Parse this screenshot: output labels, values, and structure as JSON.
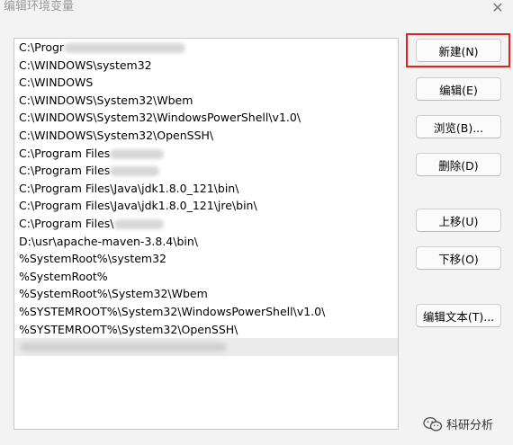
{
  "window": {
    "title": "编辑环境变量",
    "close_glyph": "✕"
  },
  "list": {
    "items": [
      {
        "text": "C:\\Progr",
        "redacted": true
      },
      {
        "text": "C:\\WINDOWS\\system32"
      },
      {
        "text": "C:\\WINDOWS"
      },
      {
        "text": "C:\\WINDOWS\\System32\\Wbem"
      },
      {
        "text": "C:\\WINDOWS\\System32\\WindowsPowerShell\\v1.0\\"
      },
      {
        "text": "C:\\WINDOWS\\System32\\OpenSSH\\"
      },
      {
        "text": "C:\\Program Files",
        "redacted": true
      },
      {
        "text": "C:\\Program Files",
        "redacted": true
      },
      {
        "text": "C:\\Program Files\\Java\\jdk1.8.0_121\\bin\\"
      },
      {
        "text": "C:\\Program Files\\Java\\jdk1.8.0_121\\jre\\bin\\"
      },
      {
        "text": "C:\\Program Files\\",
        "redacted": true
      },
      {
        "text": "D:\\usr\\apache-maven-3.8.4\\bin\\"
      },
      {
        "text": "%SystemRoot%\\system32"
      },
      {
        "text": "%SystemRoot%"
      },
      {
        "text": "%SystemRoot%\\System32\\Wbem"
      },
      {
        "text": "%SYSTEMROOT%\\System32\\WindowsPowerShell\\v1.0\\"
      },
      {
        "text": "%SYSTEMROOT%\\System32\\OpenSSH\\"
      },
      {
        "text": "",
        "redacted": true,
        "selected": true
      }
    ]
  },
  "buttons": {
    "new": "新建(N)",
    "edit": "编辑(E)",
    "browse": "浏览(B)...",
    "delete": "删除(D)",
    "move_up": "上移(U)",
    "move_down": "下移(O)",
    "edit_text": "编辑文本(T)..."
  },
  "watermark": {
    "text": "科研分析",
    "icon": "wechat-icon"
  },
  "colors": {
    "highlight": "#e0231f",
    "selected_row": "#ececec"
  }
}
